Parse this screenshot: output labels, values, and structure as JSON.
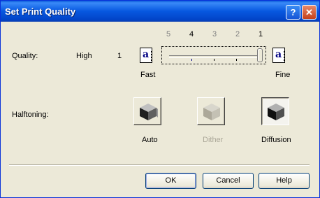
{
  "window": {
    "title": "Set Print Quality",
    "help_label": "?",
    "close_label": "✕"
  },
  "quality": {
    "label": "Quality:",
    "level_name": "High",
    "level_number": "1",
    "scale_numbers": [
      "5",
      "4",
      "3",
      "2",
      "1"
    ],
    "active_scale": "4",
    "fast_label": "Fast",
    "fine_label": "Fine",
    "icon_letter": "a",
    "slider_value": 1,
    "slider_position_fraction": 1.0
  },
  "halftoning": {
    "label": "Halftoning:",
    "options": [
      {
        "label": "Auto",
        "enabled": true,
        "selected": false
      },
      {
        "label": "Dither",
        "enabled": false,
        "selected": false
      },
      {
        "label": "Diffusion",
        "enabled": true,
        "selected": true
      }
    ]
  },
  "buttons": {
    "ok": "OK",
    "cancel": "Cancel",
    "help": "Help"
  },
  "colors": {
    "title_bar": "#0758e0",
    "dialog_bg": "#ece9d8",
    "icon_letter": "#000082"
  }
}
